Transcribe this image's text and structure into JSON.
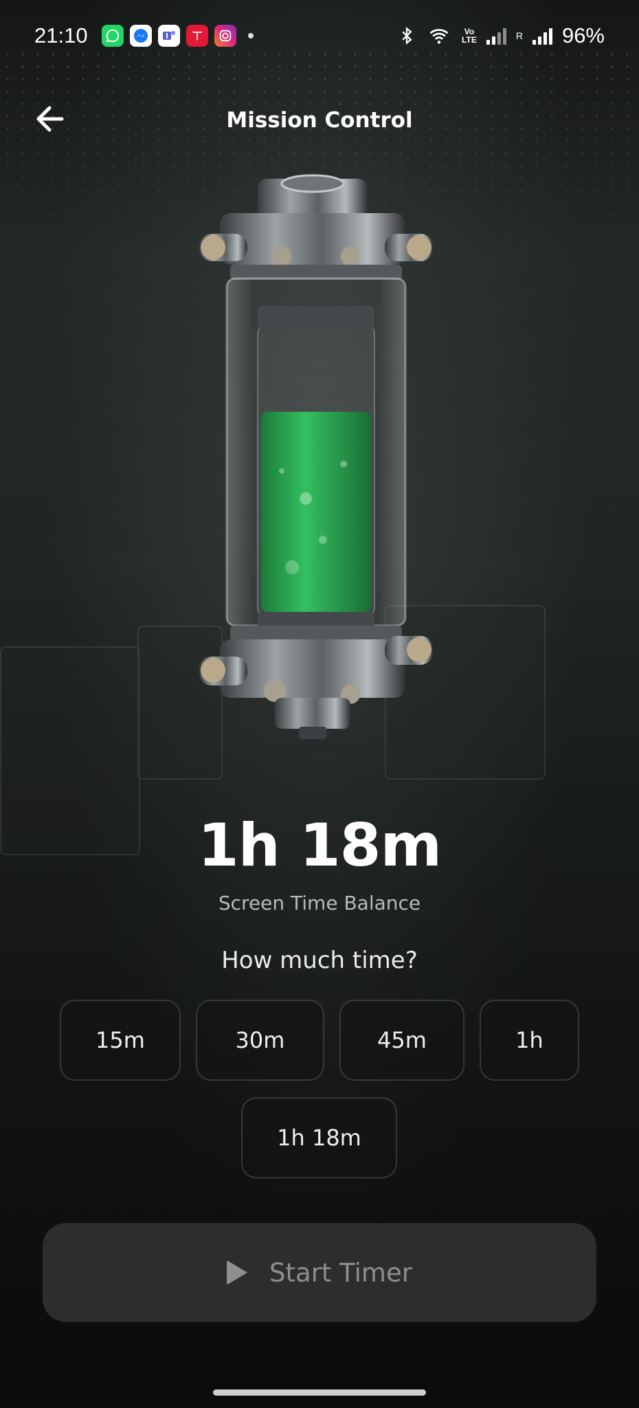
{
  "status_bar": {
    "time": "21:10",
    "battery": "96%",
    "network_label_top": "Vo",
    "network_label_bottom": "LTE",
    "roaming_label": "R",
    "notification_icons": [
      "whatsapp-icon",
      "messenger-icon",
      "teams-icon",
      "tesla-icon",
      "instagram-icon"
    ]
  },
  "header": {
    "title": "Mission Control"
  },
  "canister": {
    "fill_level": 0.7,
    "liquid_color": "#2fae55"
  },
  "balance": {
    "value": "1h 18m",
    "label": "Screen Time Balance"
  },
  "picker": {
    "question": "How much time?",
    "options": [
      "15m",
      "30m",
      "45m",
      "1h",
      "1h 18m"
    ]
  },
  "actions": {
    "start_label": "Start Timer"
  },
  "colors": {
    "accent_green": "#2fae55",
    "button_disabled_text": "#8d8f8e"
  }
}
